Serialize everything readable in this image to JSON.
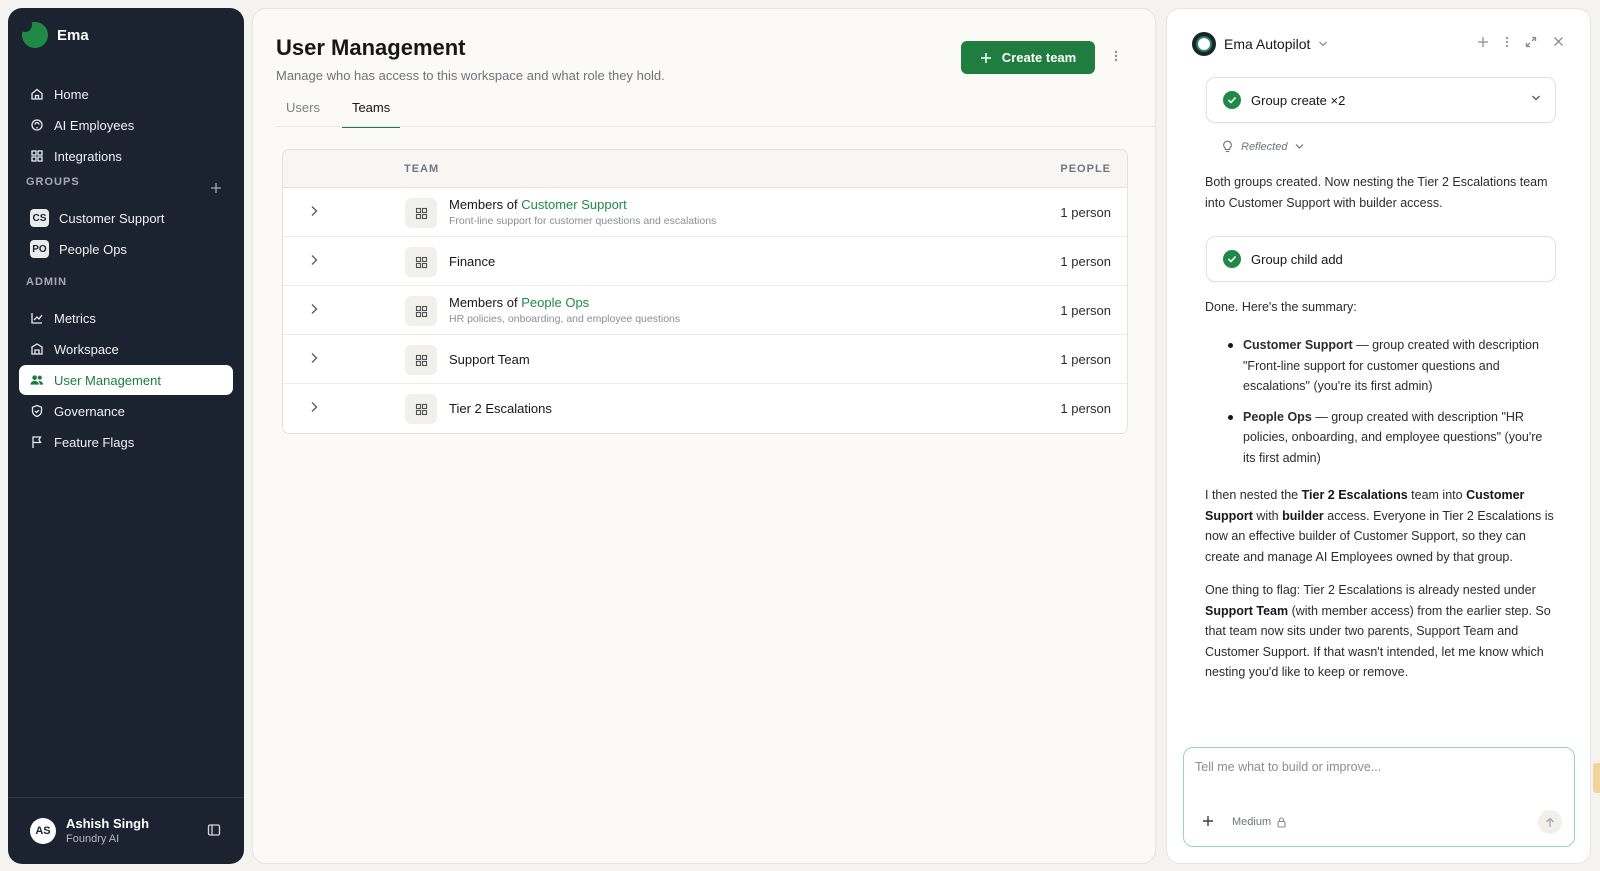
{
  "sidebar": {
    "brand": "Ema",
    "nav": [
      {
        "label": "Home",
        "icon": "home-icon"
      },
      {
        "label": "AI Employees",
        "icon": "ai-employees-icon"
      },
      {
        "label": "Integrations",
        "icon": "integrations-icon"
      }
    ],
    "groups_label": "GROUPS",
    "groups": [
      {
        "badge": "CS",
        "label": "Customer Support"
      },
      {
        "badge": "PO",
        "label": "People Ops"
      }
    ],
    "admin_label": "ADMIN",
    "admin": [
      {
        "label": "Metrics",
        "icon": "metrics-icon"
      },
      {
        "label": "Workspace",
        "icon": "workspace-icon"
      },
      {
        "label": "User Management",
        "icon": "users-icon",
        "active": true
      },
      {
        "label": "Governance",
        "icon": "shield-icon"
      },
      {
        "label": "Feature Flags",
        "icon": "flag-icon"
      }
    ],
    "user": {
      "initials": "AS",
      "name": "Ashish Singh",
      "org": "Foundry AI"
    }
  },
  "main": {
    "title": "User Management",
    "subtitle": "Manage who has access to this workspace and what role they hold.",
    "create_button": "Create team",
    "tabs": [
      {
        "label": "Users",
        "active": false
      },
      {
        "label": "Teams",
        "active": true
      }
    ],
    "table": {
      "headers": {
        "team": "TEAM",
        "people": "PEOPLE"
      },
      "rows": [
        {
          "prefix": "Members of ",
          "name": "Customer Support",
          "description": "Front-line support for customer questions and escalations",
          "people": "1 person"
        },
        {
          "prefix": "",
          "name": "Finance",
          "description": "",
          "people": "1 person"
        },
        {
          "prefix": "Members of ",
          "name": "People Ops",
          "description": "HR policies, onboarding, and employee questions",
          "people": "1 person"
        },
        {
          "prefix": "",
          "name": "Support Team",
          "description": "",
          "people": "1 person"
        },
        {
          "prefix": "",
          "name": "Tier 2 Escalations",
          "description": "",
          "people": "1 person"
        }
      ]
    }
  },
  "panel": {
    "title": "Ema Autopilot",
    "step1": "Group create ×2",
    "reflected": "Reflected",
    "msg1": "Both groups created. Now nesting the Tier 2 Escalations team into Customer Support with builder access.",
    "step2": "Group child add",
    "msg2": "Done. Here's the summary:",
    "bullets": [
      {
        "bold": "Customer Support",
        "text": " — group created with description \"Front-line support for customer questions and escalations\" (you're its first admin)"
      },
      {
        "bold": "People Ops",
        "text": " — group created with description \"HR policies, onboarding, and employee questions\" (you're its first admin)"
      }
    ],
    "msg3": {
      "t1": "I then nested the ",
      "b1": "Tier 2 Escalations",
      "t2": " team into ",
      "b2": "Customer Support",
      "t3": " with ",
      "b3": "builder",
      "t4": " access. Everyone in Tier 2 Escalations is now an effective builder of Customer Support, so they can create and manage AI Employees owned by that group."
    },
    "msg4": {
      "t1": "One thing to flag: Tier 2 Escalations is already nested under ",
      "b1": "Support Team",
      "t2": " (with member access) from the earlier step. So that team now sits under two parents, Support Team and Customer Support. If that wasn't intended, let me know which nesting you'd like to keep or remove."
    },
    "composer": {
      "placeholder": "Tell me what to build or improve...",
      "value": "",
      "model": "Medium"
    }
  },
  "colors": {
    "sidebar_bg": "#1c2330",
    "accent_green": "#1f7d3f",
    "link_green": "#1f8a45"
  }
}
